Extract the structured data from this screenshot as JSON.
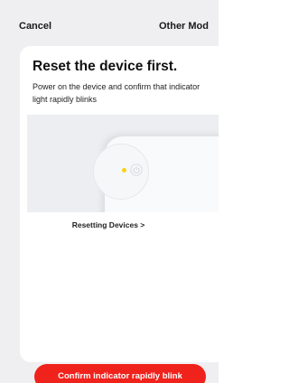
{
  "header": {
    "cancel_label": "Cancel",
    "other_mode_label": "Other Mod"
  },
  "card": {
    "title": "Reset the device first.",
    "description": "Power on the device and confirm that indicator light rapidly blinks",
    "resetting_link": "Resetting Devices >",
    "confirm_button": "Confirm indicator rapidly blink"
  },
  "icons": {
    "indicator": "indicator-light-icon",
    "power": "power-icon"
  },
  "colors": {
    "accent": "#f0221c",
    "indicator": "#f5d31a",
    "background": "#efeff1"
  }
}
